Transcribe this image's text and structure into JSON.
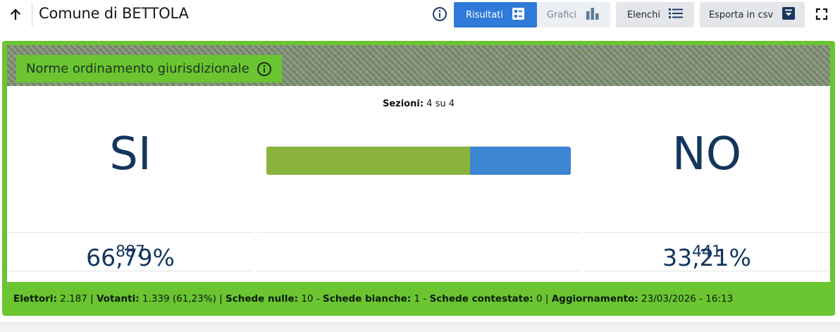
{
  "header": {
    "title": "Comune di BETTOLA",
    "tabs": [
      {
        "label": "Risultati",
        "icon": "list-detail-icon",
        "active": true
      },
      {
        "label": "Grafici",
        "icon": "bar-chart-icon",
        "active": false
      }
    ],
    "lists_label": "Elenchi",
    "export_label": "Esporta in csv"
  },
  "card": {
    "topic": "Norme ordinamento giurisdizionale",
    "sections_label": "Sezioni:",
    "sections_value": "4 su 4",
    "yes": {
      "label": "SI",
      "votes": "887",
      "percent": "66,79%",
      "color": "#8ab43d",
      "share": 66.79
    },
    "no": {
      "label": "NO",
      "votes": "441",
      "percent": "33,21%",
      "color": "#3b85d1",
      "share": 33.21
    },
    "accent_color": "#6ac531"
  },
  "stats": {
    "electors_label": "Elettori:",
    "electors_value": "2.187",
    "voters_label": "Votanti:",
    "voters_value": "1.339 (61,23%)",
    "null_label": "Schede nulle:",
    "null_value": "10",
    "blank_label": "Schede bianche:",
    "blank_value": "1",
    "contested_label": "Schede contestate:",
    "contested_value": "0",
    "updated_label": "Aggiornamento:",
    "updated_value": "23/03/2026 - 16:13"
  }
}
